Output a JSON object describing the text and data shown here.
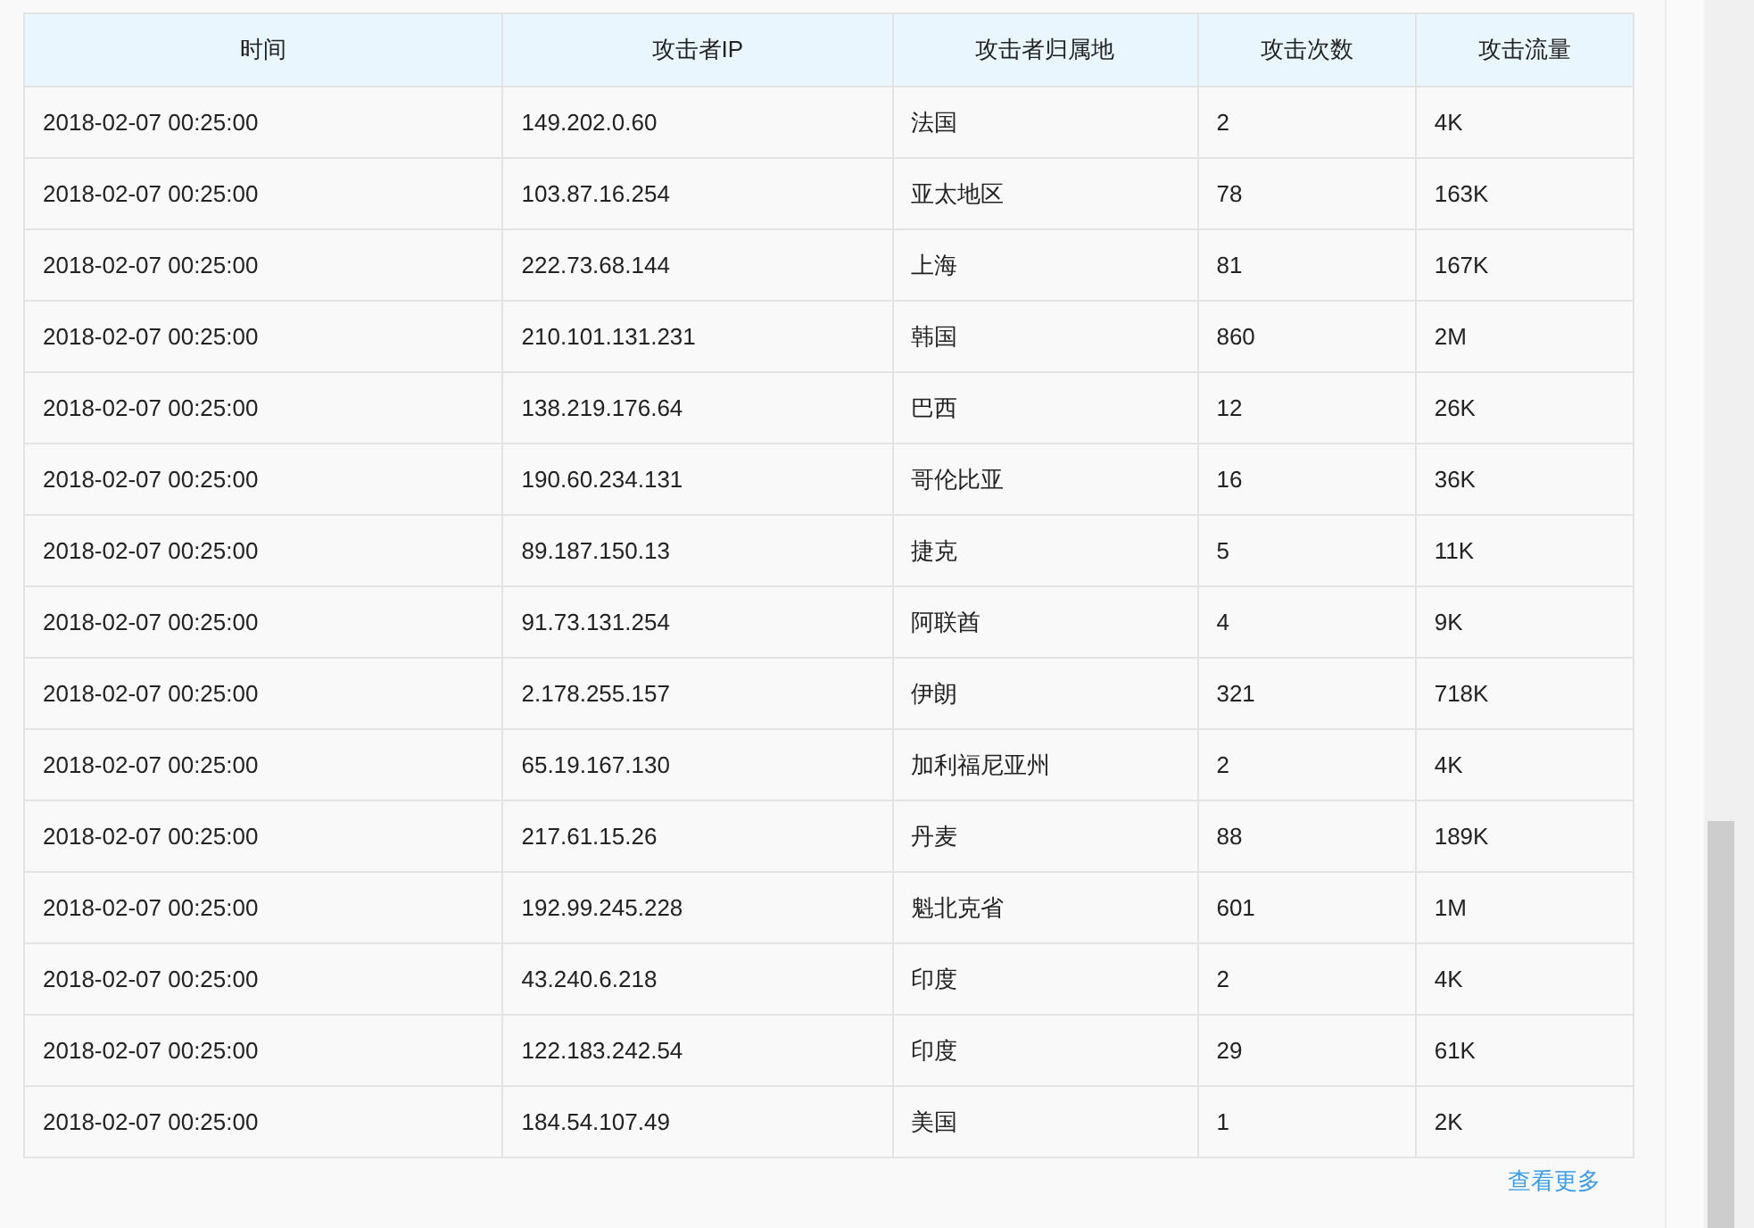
{
  "table": {
    "columns": [
      "时间",
      "攻击者IP",
      "攻击者归属地",
      "攻击次数",
      "攻击流量"
    ],
    "rows": [
      [
        "2018-02-07 00:25:00",
        "149.202.0.60",
        "法国",
        "2",
        "4K"
      ],
      [
        "2018-02-07 00:25:00",
        "103.87.16.254",
        "亚太地区",
        "78",
        "163K"
      ],
      [
        "2018-02-07 00:25:00",
        "222.73.68.144",
        "上海",
        "81",
        "167K"
      ],
      [
        "2018-02-07 00:25:00",
        "210.101.131.231",
        "韩国",
        "860",
        "2M"
      ],
      [
        "2018-02-07 00:25:00",
        "138.219.176.64",
        "巴西",
        "12",
        "26K"
      ],
      [
        "2018-02-07 00:25:00",
        "190.60.234.131",
        "哥伦比亚",
        "16",
        "36K"
      ],
      [
        "2018-02-07 00:25:00",
        "89.187.150.13",
        "捷克",
        "5",
        "11K"
      ],
      [
        "2018-02-07 00:25:00",
        "91.73.131.254",
        "阿联酋",
        "4",
        "9K"
      ],
      [
        "2018-02-07 00:25:00",
        "2.178.255.157",
        "伊朗",
        "321",
        "718K"
      ],
      [
        "2018-02-07 00:25:00",
        "65.19.167.130",
        "加利福尼亚州",
        "2",
        "4K"
      ],
      [
        "2018-02-07 00:25:00",
        "217.61.15.26",
        "丹麦",
        "88",
        "189K"
      ],
      [
        "2018-02-07 00:25:00",
        "192.99.245.228",
        "魁北克省",
        "601",
        "1M"
      ],
      [
        "2018-02-07 00:25:00",
        "43.240.6.218",
        "印度",
        "2",
        "4K"
      ],
      [
        "2018-02-07 00:25:00",
        "122.183.242.54",
        "印度",
        "29",
        "61K"
      ],
      [
        "2018-02-07 00:25:00",
        "184.54.107.49",
        "美国",
        "1",
        "2K"
      ]
    ]
  },
  "more_link": "查看更多"
}
